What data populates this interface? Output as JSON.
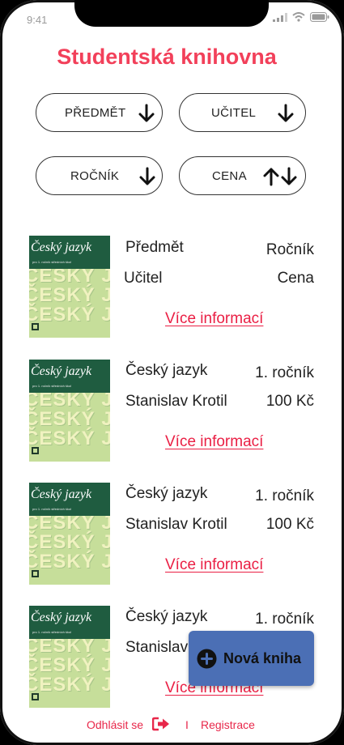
{
  "status_bar": {
    "time": "9:41"
  },
  "title": "Studentská knihovna",
  "filters": [
    {
      "label": "PŘEDMĚT",
      "icon": "arrow-down-icon"
    },
    {
      "label": "UČITEL",
      "icon": "arrow-down-icon"
    },
    {
      "label": "ROČNÍK",
      "icon": "arrow-down-icon"
    },
    {
      "label": "CENA",
      "icon": "arrow-up-down-icon"
    }
  ],
  "books": [
    {
      "subject": "Předmět",
      "year": "Ročník",
      "teacher": "Učitel",
      "price": "Cena",
      "more": "Více informací",
      "cover": {
        "title": "Český jazyk",
        "subtitle": "pro 1. ročník středních škol",
        "big_text": "ČESKÝ JAZYK"
      }
    },
    {
      "subject": "Český jazyk",
      "year": "1. ročník",
      "teacher": "Stanislav Krotil",
      "price": "100 Kč",
      "more": "Více informací",
      "cover": {
        "title": "Český jazyk",
        "subtitle": "pro 1. ročník středních škol",
        "big_text": "ČESKÝ JAZYK"
      }
    },
    {
      "subject": "Český jazyk",
      "year": "1. ročník",
      "teacher": "Stanislav Krotil",
      "price": "100 Kč",
      "more": "Více informací",
      "cover": {
        "title": "Český jazyk",
        "subtitle": "pro 1. ročník středních škol",
        "big_text": "ČESKÝ JAZYK"
      }
    },
    {
      "subject": "Český jazyk",
      "year": "1. ročník",
      "teacher": "Stanislav",
      "price": "",
      "more": "Více informací",
      "cover": {
        "title": "Český jazyk",
        "subtitle": "pro 1. ročník středních škol",
        "big_text": "ČESKÝ JAZYK"
      }
    }
  ],
  "fab": {
    "label": "Nová kniha",
    "icon": "plus-circle-icon"
  },
  "footer": {
    "logout": "Odhlásit se",
    "separator": "I",
    "register": "Registrace",
    "logout_icon": "logout-icon"
  },
  "colors": {
    "accent": "#f2405a",
    "link": "#ea1f44",
    "fab": "#4b6fb5"
  }
}
